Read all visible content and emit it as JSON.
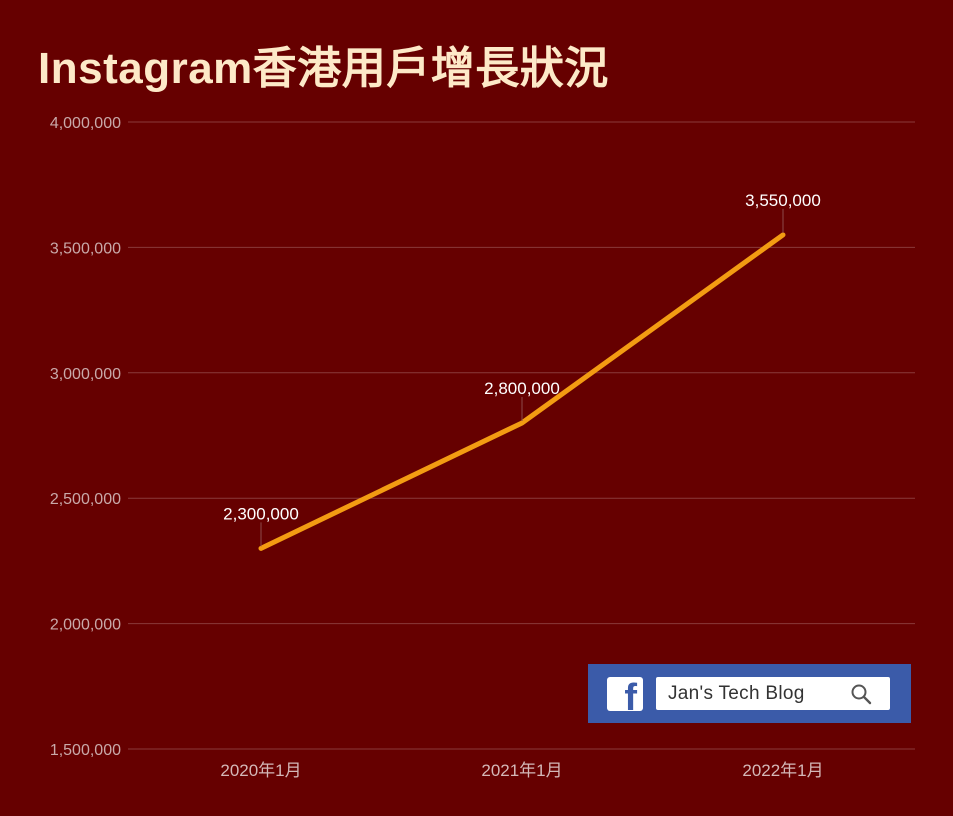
{
  "chart_data": {
    "type": "line",
    "title": "Instagram香港用戶增長狀況",
    "categories": [
      "2020年1月",
      "2021年1月",
      "2022年1月"
    ],
    "series": [
      {
        "values": [
          2300000,
          2800000,
          3550000
        ],
        "color": "#f39c12"
      }
    ],
    "data_labels": [
      "2,300,000",
      "2,800,000",
      "3,550,000"
    ],
    "ylim": [
      1500000,
      4000000
    ],
    "yticks": [
      1500000,
      2000000,
      2500000,
      3000000,
      3500000,
      4000000
    ],
    "ytick_labels": [
      "1,500,000",
      "2,000,000",
      "2,500,000",
      "3,000,000",
      "3,500,000",
      "4,000,000"
    ],
    "grid": true,
    "xlabel": "",
    "ylabel": ""
  },
  "colors": {
    "background": "#660000",
    "title": "#fde9c8",
    "line": "#f39c12",
    "grid": "#8a3a3a",
    "facebook_blue": "#3b5ba9"
  },
  "badge": {
    "logo_letter": "f",
    "logo_icon": "facebook-icon",
    "search_text": "Jan's Tech Blog",
    "search_icon": "search-icon"
  }
}
